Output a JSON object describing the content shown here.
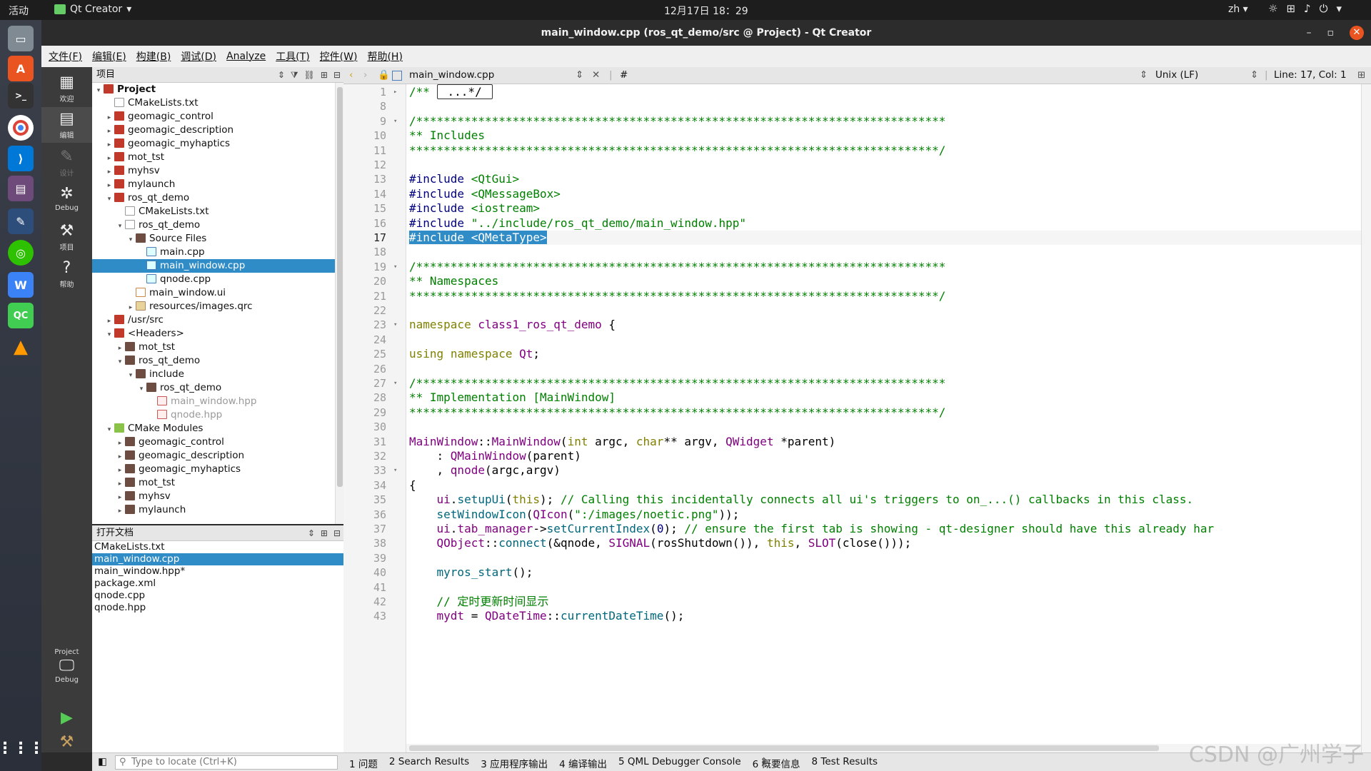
{
  "topbar": {
    "activities": "活动",
    "app_name": "Qt Creator",
    "clock": "12月17日  18：29",
    "language": "zh"
  },
  "window": {
    "title": "main_window.cpp (ros_qt_demo/src @ Project) - Qt Creator"
  },
  "menu": [
    "文件(F)",
    "编辑(E)",
    "构建(B)",
    "调试(D)",
    "Analyze",
    "工具(T)",
    "控件(W)",
    "帮助(H)"
  ],
  "modes": {
    "welcome": "欢迎",
    "edit": "编辑",
    "design": "设计",
    "debug": "Debug",
    "projects": "项目",
    "help": "帮助",
    "kit_project": "Project",
    "kit_build": "Debug"
  },
  "project_panel": {
    "title": "项目",
    "tree": [
      {
        "label": "Project",
        "depth": 0,
        "icon": "project-icon",
        "expanded": true,
        "bold": true
      },
      {
        "label": "CMakeLists.txt",
        "depth": 1,
        "icon": "file-icon"
      },
      {
        "label": "geomagic_control",
        "depth": 1,
        "icon": "project-icon",
        "collapsed": true
      },
      {
        "label": "geomagic_description",
        "depth": 1,
        "icon": "project-icon",
        "collapsed": true
      },
      {
        "label": "geomagic_myhaptics",
        "depth": 1,
        "icon": "project-icon",
        "collapsed": true
      },
      {
        "label": "mot_tst",
        "depth": 1,
        "icon": "project-icon",
        "collapsed": true
      },
      {
        "label": "myhsv",
        "depth": 1,
        "icon": "project-icon",
        "collapsed": true
      },
      {
        "label": "mylaunch",
        "depth": 1,
        "icon": "project-icon",
        "collapsed": true
      },
      {
        "label": "ros_qt_demo",
        "depth": 1,
        "icon": "project-icon",
        "expanded": true
      },
      {
        "label": "CMakeLists.txt",
        "depth": 2,
        "icon": "file-icon"
      },
      {
        "label": "ros_qt_demo",
        "depth": 2,
        "icon": "hammer-icon",
        "expanded": true
      },
      {
        "label": "Source Files",
        "depth": 3,
        "icon": "folder-icon",
        "expanded": true
      },
      {
        "label": "main.cpp",
        "depth": 4,
        "icon": "cpp-file-icon"
      },
      {
        "label": "main_window.cpp",
        "depth": 4,
        "icon": "cpp-file-icon",
        "selected": true
      },
      {
        "label": "qnode.cpp",
        "depth": 4,
        "icon": "cpp-file-icon"
      },
      {
        "label": "main_window.ui",
        "depth": 3,
        "icon": "ui-file-icon"
      },
      {
        "label": "resources/images.qrc",
        "depth": 3,
        "icon": "qrc-file-icon",
        "collapsed": true
      },
      {
        "label": "/usr/src",
        "depth": 1,
        "icon": "project-icon",
        "collapsed": true
      },
      {
        "label": "<Headers>",
        "depth": 1,
        "icon": "project-icon",
        "expanded": true
      },
      {
        "label": "mot_tst",
        "depth": 2,
        "icon": "folder-icon",
        "collapsed": true
      },
      {
        "label": "ros_qt_demo",
        "depth": 2,
        "icon": "folder-icon",
        "expanded": true
      },
      {
        "label": "include",
        "depth": 3,
        "icon": "folder-icon",
        "expanded": true
      },
      {
        "label": "ros_qt_demo",
        "depth": 4,
        "icon": "folder-icon",
        "expanded": true
      },
      {
        "label": "main_window.hpp",
        "depth": 5,
        "icon": "hpp-file-icon",
        "dim": true
      },
      {
        "label": "qnode.hpp",
        "depth": 5,
        "icon": "hpp-file-icon",
        "dim": true
      },
      {
        "label": "CMake Modules",
        "depth": 1,
        "icon": "cmake-icon",
        "expanded": true
      },
      {
        "label": "geomagic_control",
        "depth": 2,
        "icon": "folder-icon",
        "collapsed": true
      },
      {
        "label": "geomagic_description",
        "depth": 2,
        "icon": "folder-icon",
        "collapsed": true
      },
      {
        "label": "geomagic_myhaptics",
        "depth": 2,
        "icon": "folder-icon",
        "collapsed": true
      },
      {
        "label": "mot_tst",
        "depth": 2,
        "icon": "folder-icon",
        "collapsed": true
      },
      {
        "label": "myhsv",
        "depth": 2,
        "icon": "folder-icon",
        "collapsed": true
      },
      {
        "label": "mylaunch",
        "depth": 2,
        "icon": "folder-icon",
        "collapsed": true
      }
    ]
  },
  "open_documents": {
    "title": "打开文档",
    "items": [
      {
        "label": "CMakeLists.txt"
      },
      {
        "label": "main_window.cpp",
        "selected": true
      },
      {
        "label": "main_window.hpp*"
      },
      {
        "label": "package.xml"
      },
      {
        "label": "qnode.cpp"
      },
      {
        "label": "qnode.hpp"
      }
    ]
  },
  "editor_toolbar": {
    "file": "main_window.cpp",
    "symbol": "#",
    "line_ending": "Unix (LF)",
    "position": "Line: 17, Col: 1"
  },
  "editor": {
    "current_line": 17,
    "lines": [
      {
        "n": "1",
        "fold": "▸",
        "html": "<span class=\"c\">/** </span><span class=\"foldbox\">...*/</span>"
      },
      {
        "n": "8",
        "html": ""
      },
      {
        "n": "9",
        "fold": "▾",
        "html": "<span class=\"c\">/*****************************************************************************</span>"
      },
      {
        "n": "10",
        "html": "<span class=\"c\">** Includes</span>"
      },
      {
        "n": "11",
        "html": "<span class=\"c\">*****************************************************************************/</span>"
      },
      {
        "n": "12",
        "html": ""
      },
      {
        "n": "13",
        "html": "<span class=\"pp\">#include</span> <span class=\"str\">&lt;QtGui&gt;</span>"
      },
      {
        "n": "14",
        "html": "<span class=\"pp\">#include</span> <span class=\"str\">&lt;QMessageBox&gt;</span>"
      },
      {
        "n": "15",
        "html": "<span class=\"pp\">#include</span> <span class=\"str\">&lt;iostream&gt;</span>"
      },
      {
        "n": "16",
        "html": "<span class=\"pp\">#include</span> <span class=\"str\">\"../include/ros_qt_demo/main_window.hpp\"</span>"
      },
      {
        "n": "17",
        "html": "<span class=\"hl\">#include &lt;QMetaType&gt;</span>"
      },
      {
        "n": "18",
        "html": ""
      },
      {
        "n": "19",
        "fold": "▾",
        "html": "<span class=\"c\">/*****************************************************************************</span>"
      },
      {
        "n": "20",
        "html": "<span class=\"c\">** Namespaces</span>"
      },
      {
        "n": "21",
        "html": "<span class=\"c\">*****************************************************************************/</span>"
      },
      {
        "n": "22",
        "html": ""
      },
      {
        "n": "23",
        "fold": "▾",
        "html": "<span class=\"kw\">namespace</span> <span class=\"ty\">class1_ros_qt_demo</span> {"
      },
      {
        "n": "24",
        "html": ""
      },
      {
        "n": "25",
        "html": "<span class=\"kw\">using</span> <span class=\"kw\">namespace</span> <span class=\"ty\">Qt</span>;"
      },
      {
        "n": "26",
        "html": ""
      },
      {
        "n": "27",
        "fold": "▾",
        "html": "<span class=\"c\">/*****************************************************************************</span>"
      },
      {
        "n": "28",
        "html": "<span class=\"c\">** Implementation [MainWindow]</span>"
      },
      {
        "n": "29",
        "html": "<span class=\"c\">*****************************************************************************/</span>"
      },
      {
        "n": "30",
        "html": ""
      },
      {
        "n": "31",
        "html": "<span class=\"ty\">MainWindow</span>::<span class=\"ty\">MainWindow</span>(<span class=\"kw\">int</span> argc, <span class=\"kw\">char</span>** argv, <span class=\"ty\">QWidget</span> *parent)"
      },
      {
        "n": "32",
        "html": "    : <span class=\"ty\">QMainWindow</span>(parent)"
      },
      {
        "n": "33",
        "fold": "▾",
        "html": "    , <span class=\"ty\">qnode</span>(argc,argv)"
      },
      {
        "n": "34",
        "html": "{"
      },
      {
        "n": "35",
        "html": "    <span class=\"ty\">ui</span>.<span class=\"fn\">setupUi</span>(<span class=\"kw\">this</span>); <span class=\"c\">// Calling this incidentally connects all ui's triggers to on_...() callbacks in this class.</span>"
      },
      {
        "n": "36",
        "html": "    <span class=\"fn\">setWindowIcon</span>(<span class=\"ty\">QIcon</span>(<span class=\"str\">\":/images/noetic.png\"</span>));"
      },
      {
        "n": "37",
        "html": "    <span class=\"ty\">ui</span>.<span class=\"ty\">tab_manager</span>-&gt;<span class=\"fn\">setCurrentIndex</span>(<span class=\"num\">0</span>); <span class=\"c\">// ensure the first tab is showing - qt-designer should have this already har</span>"
      },
      {
        "n": "38",
        "html": "    <span class=\"ty\">QObject</span>::<span class=\"fn\">connect</span>(&amp;qnode, <span class=\"ty\">SIGNAL</span>(rosShutdown()), <span class=\"kw\">this</span>, <span class=\"ty\">SLOT</span>(close()));"
      },
      {
        "n": "39",
        "html": ""
      },
      {
        "n": "40",
        "html": "    <span class=\"fn\">myros_start</span>();"
      },
      {
        "n": "41",
        "html": ""
      },
      {
        "n": "42",
        "html": "    <span class=\"c\">// 定时更新时间显示</span>"
      },
      {
        "n": "43",
        "html": "    <span class=\"ty\">mydt</span> = <span class=\"ty\">QDateTime</span>::<span class=\"fn\">currentDateTime</span>();"
      }
    ]
  },
  "bottom": {
    "locator_placeholder": "Type to locate (Ctrl+K)",
    "tabs": [
      "1 问题",
      "2 Search Results",
      "3 应用程序输出",
      "4 编译输出",
      "5 QML Debugger Console",
      "6 概要信息",
      "8 Test Results"
    ]
  },
  "watermark": "CSDN @广州学子"
}
